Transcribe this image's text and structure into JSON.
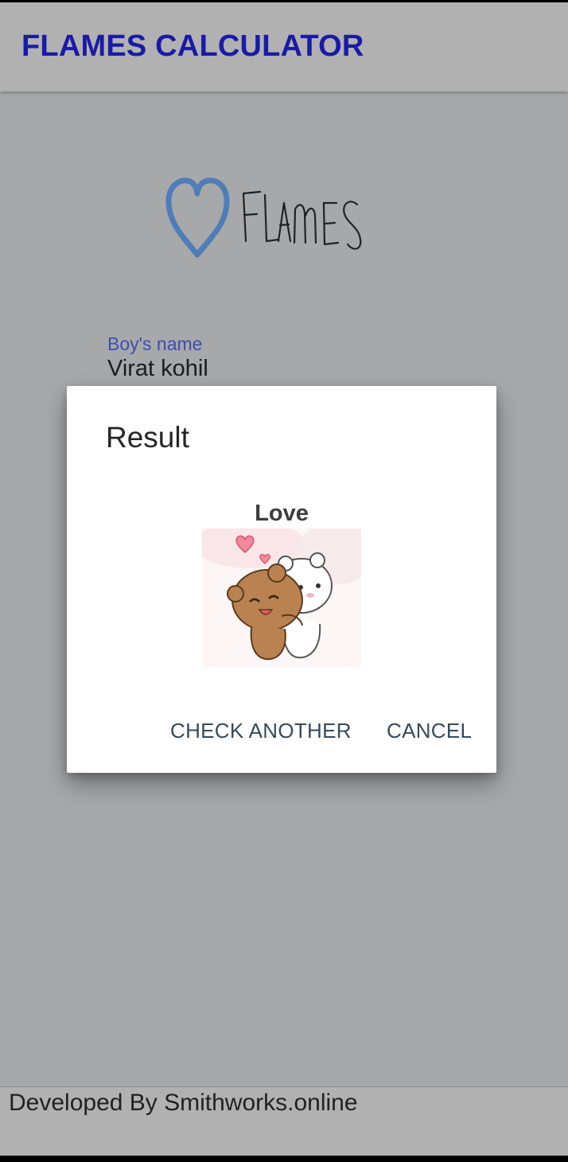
{
  "appbar": {
    "title": "FLAMES CALCULATOR"
  },
  "logo": {
    "icon": "heart-icon",
    "wordmark": "FLAMES",
    "color": "#4f7db8"
  },
  "form": {
    "boys_name_label": "Boy's name",
    "boys_name_value": "Virat kohil"
  },
  "dialog": {
    "title": "Result",
    "result": "Love",
    "image": "hugging-bears-sticker",
    "check_another_label": "CHECK ANOTHER",
    "cancel_label": "CANCEL"
  },
  "footer": {
    "text": "Developed By Smithworks.online"
  }
}
